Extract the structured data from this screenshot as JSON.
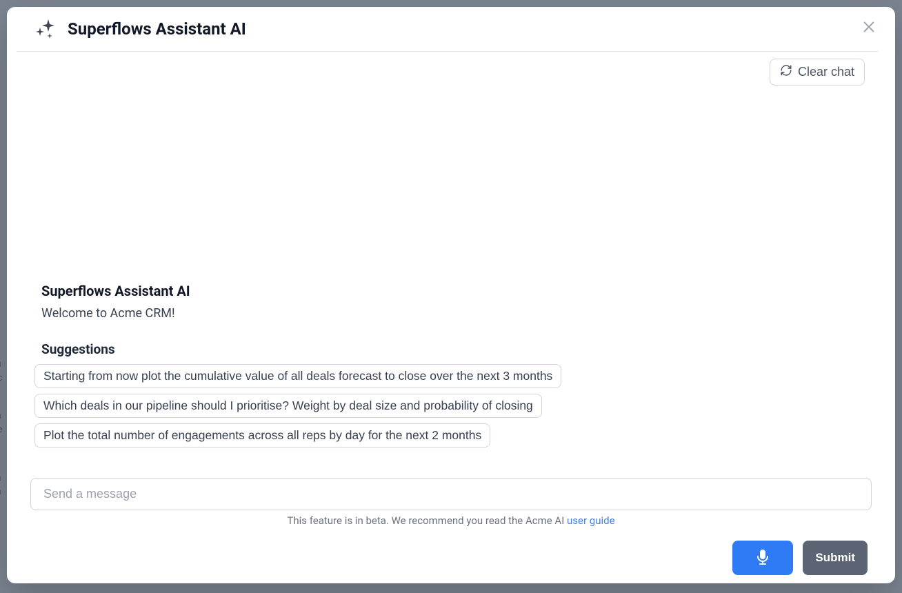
{
  "modal": {
    "title": "Superflows Assistant AI"
  },
  "toolbar": {
    "clear_chat_label": "Clear chat"
  },
  "chat": {
    "assistant_name": "Superflows Assistant AI",
    "welcome_message": "Welcome to Acme CRM!",
    "suggestions_heading": "Suggestions",
    "suggestions": [
      "Starting from now plot the cumulative value of all deals forecast to close over the next 3 months",
      "Which deals in our pipeline should I prioritise? Weight by deal size and probability of closing",
      "Plot the total number of engagements across all reps by day for the next 2 months"
    ]
  },
  "input": {
    "placeholder": "Send a message"
  },
  "footer": {
    "beta_notice_prefix": "This feature is in beta. We recommend you read the Acme AI ",
    "beta_notice_link": "user guide"
  },
  "actions": {
    "submit_label": "Submit"
  }
}
